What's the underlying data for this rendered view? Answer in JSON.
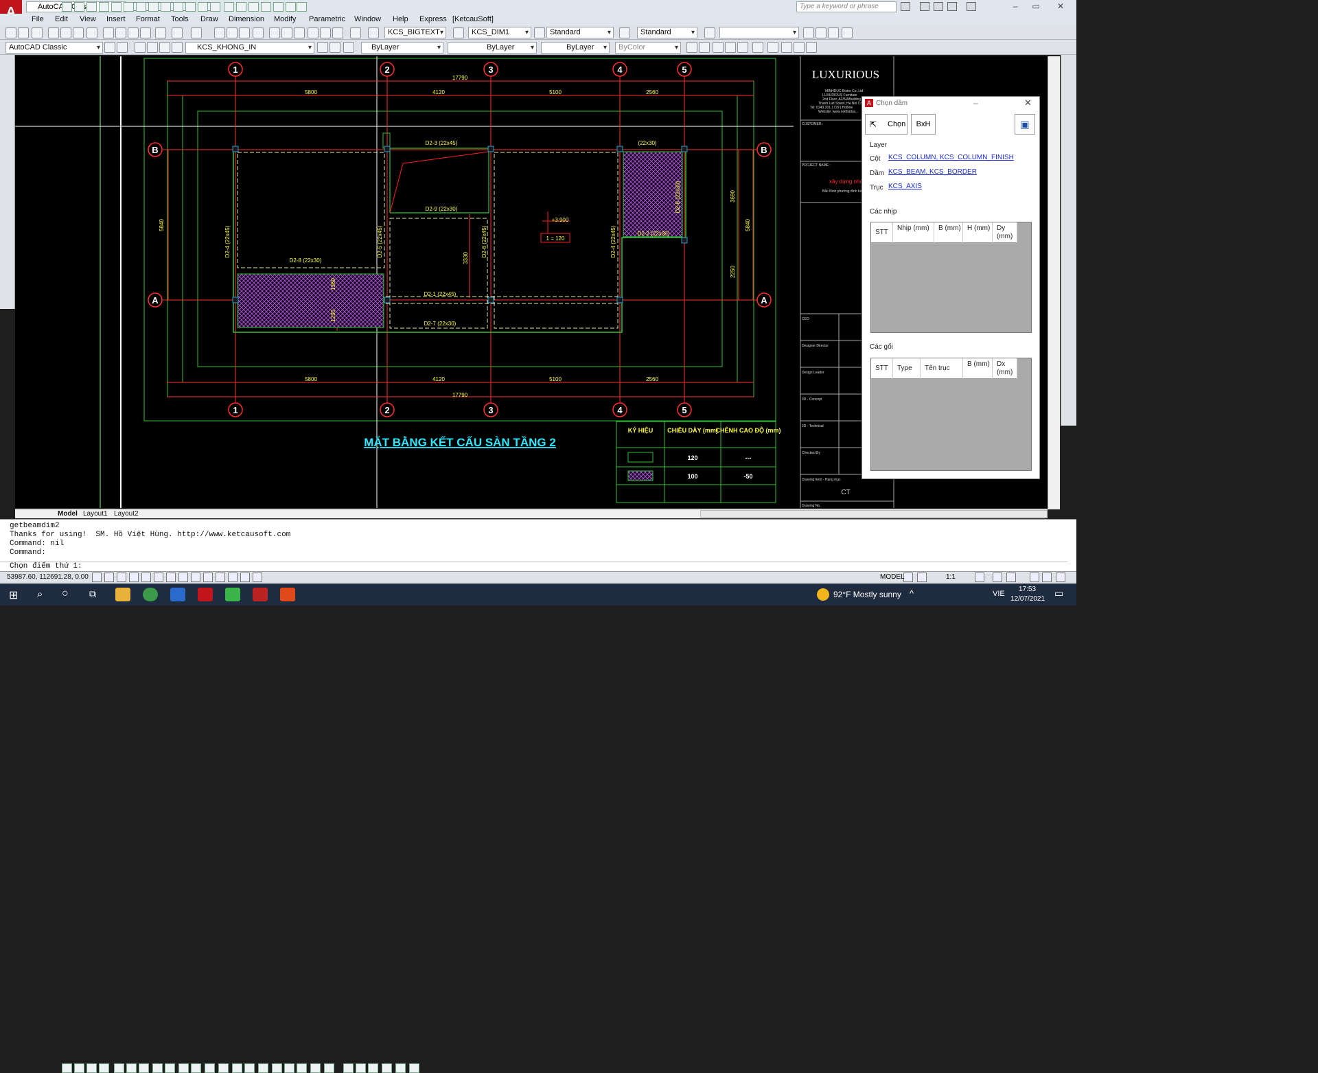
{
  "workspace": "AutoCAD Classic",
  "search_placeholder": "Type a keyword or phrase",
  "app_title": "[KetcauSoft]",
  "menu": [
    "File",
    "Edit",
    "View",
    "Insert",
    "Format",
    "Tools",
    "Draw",
    "Dimension",
    "Modify",
    "Parametric",
    "Window",
    "Help",
    "Express",
    "[KetcauSoft]"
  ],
  "toolbar1": {
    "text_style": "KCS_BIGTEXT",
    "dim_style": "KCS_DIM1",
    "table_style": "Standard",
    "mleader_style": "Standard"
  },
  "toolbar2": {
    "workspace": "AutoCAD Classic",
    "layer": "KCS_KHONG_IN",
    "color": "ByLayer",
    "linetype": "ByLayer",
    "lineweight": "ByLayer",
    "plotstyle": "ByColor"
  },
  "drawing": {
    "grid_axes_top": [
      "1",
      "2",
      "3",
      "4",
      "5"
    ],
    "grid_axes_side": [
      "B",
      "A"
    ],
    "dim_total": "17790",
    "dims_top": [
      "5800",
      "4120",
      "5100",
      "2560"
    ],
    "dims_side_left": "5840",
    "dims_side_right": [
      "3690",
      "2250"
    ],
    "beams": [
      "D2-3 (22x45)",
      "(22x30)",
      "D2-9 (22x30)",
      "D2-8 (22x30)",
      "D2-1 (22x45)",
      "D2-7 (22x30)",
      "D2-2 (22x30)",
      "D2-4 (22x45)",
      "D2-5 (22x45)",
      "D2-6 (22x45)",
      "D2-8 (22x30)",
      "D2-4 (22x45)"
    ],
    "dim_3330": "3330",
    "dim_1360": "1360",
    "dim_1230": "1230",
    "level": "+3.900",
    "slab_tag": "1 = 120",
    "plan_title": "MẶT BẰNG KẾT CẤU SÀN TẦNG 2",
    "legend": {
      "headers": [
        "KÝ HIỆU",
        "CHIỀU DÀY (mm)",
        "CHÊNH CAO ĐỘ (mm)"
      ],
      "rows": [
        [
          "",
          "120",
          "---"
        ],
        [
          "",
          "100",
          "-50"
        ]
      ]
    },
    "titleblock": {
      "brand": "LUXURIOUS",
      "company_lines": [
        "MINHDUC Bistro Co.,Ltd",
        "LUXURIOUS Furniture",
        "2nd Floor, A2/5/ABuilding",
        "Thanh Liet Street, Ha Noi City",
        "Tel: 0243.201.1729 | Hotline",
        "Website: www.noithatlux..."
      ],
      "customer": "CUSTOMER :",
      "project": "PROJECT NAME :",
      "project_text": "xây dựng nhà l",
      "project_sub": "Bắc Ninh phường đình bảng",
      "roles": [
        "CEO",
        "Designer Director",
        "Design Leader",
        "3D - Concept",
        "2D - Technical",
        "Checked By",
        "Drawing Item - Hạng mục",
        "Drawing No."
      ],
      "ct": "CT"
    }
  },
  "dialog": {
    "title": "Chọn dầm",
    "btn_select": "Chọn",
    "btn_bxh": "BxH",
    "layer_label": "Layer",
    "column_label": "Cột",
    "column_value": "KCS_COLUMN, KCS_COLUMN_FINISH",
    "beam_label": "Dầm",
    "beam_value": "KCS_BEAM, KCS_BORDER",
    "axis_label": "Trục",
    "axis_value": "KCS_AXIS",
    "spans_label": "Các nhịp",
    "spans_headers": [
      "STT",
      "Nhịp (mm)",
      "B (mm)",
      "H (mm)",
      "Dy (mm)"
    ],
    "supports_label": "Các gối",
    "supports_headers": [
      "STT",
      "Type",
      "Tên trục",
      "B (mm)",
      "Dx (mm)"
    ]
  },
  "layout_tabs": [
    "Model",
    "Layout1",
    "Layout2"
  ],
  "command": {
    "lines": [
      "getbeamdim2",
      "Thanks for using!  SM. Hồ Việt Hùng. http://www.ketcausoft.com",
      "Command: nil",
      "Command:"
    ],
    "prompt": "Chọn điểm thứ 1:"
  },
  "status": {
    "coords": "53987.60, 112691.28, 0.00",
    "model": "MODEL",
    "scale": "1:1"
  },
  "taskbar": {
    "weather": "92°F  Mostly sunny",
    "lang": "VIE",
    "time": "17:53",
    "date": "12/07/2021"
  }
}
